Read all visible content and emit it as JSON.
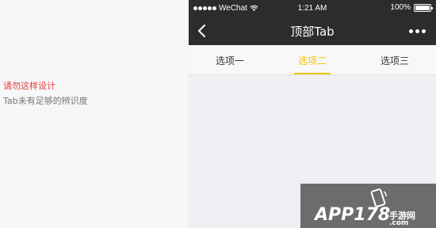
{
  "annotation": {
    "warning": "请勿这样设计",
    "description": "Tab未有足够的辨识度"
  },
  "statusbar": {
    "carrier": "WeChat",
    "time": "1:21 AM",
    "battery": "100%",
    "battery_level": 1.0
  },
  "navbar": {
    "title": "顶部Tab",
    "back_icon": "chevron-left-icon",
    "more_icon": "more-dots-icon"
  },
  "tabs": [
    {
      "label": "选项一",
      "active": false
    },
    {
      "label": "选项二",
      "active": true
    },
    {
      "label": "选项三",
      "active": false
    }
  ],
  "colors": {
    "accent": "#f5c400",
    "warning": "#e33b3b",
    "navbar": "#2c2c2c"
  },
  "watermark": {
    "brand": "APP178",
    "cn": "手游网",
    "domain": ".com"
  }
}
